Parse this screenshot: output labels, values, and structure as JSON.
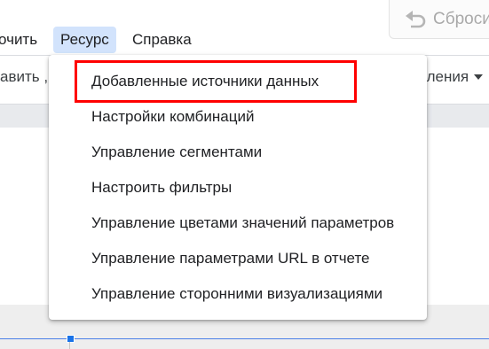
{
  "top_bar": {
    "reset_label": "Сброси",
    "reset_icon": "undo-icon"
  },
  "menubar": {
    "items": [
      {
        "label": "очить"
      },
      {
        "label": "Ресурс"
      },
      {
        "label": "Справка"
      }
    ]
  },
  "toolbar": {
    "left_label": "авить ,",
    "right_label": "вления"
  },
  "resource_menu": {
    "items": [
      {
        "label": "Добавленные источники данных"
      },
      {
        "label": "Настройки комбинаций"
      },
      {
        "label": "Управление сегментами"
      },
      {
        "label": "Настроить фильтры"
      },
      {
        "label": "Управление цветами значений параметров"
      },
      {
        "label": "Управление параметрами URL в отчете"
      },
      {
        "label": "Управление сторонними визуализациями"
      }
    ]
  },
  "colors": {
    "active_menu_bg": "#d2e3fc",
    "highlight_border": "#ff0000",
    "selection_blue": "#1a73e8"
  }
}
